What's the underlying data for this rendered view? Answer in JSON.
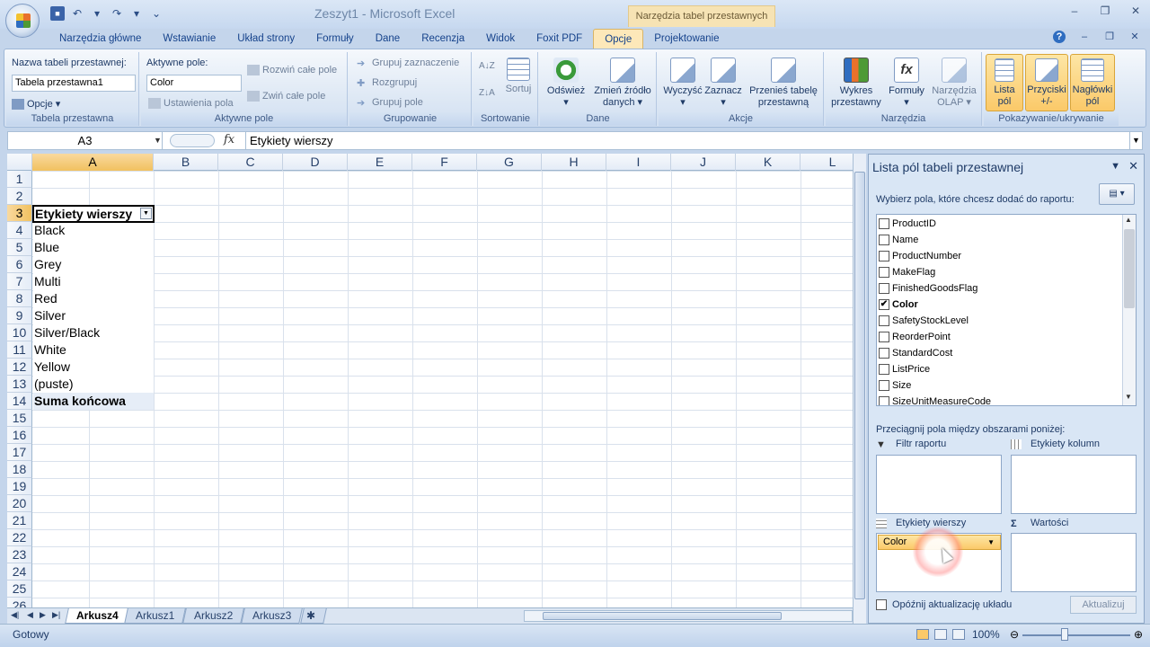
{
  "window": {
    "title": "Zeszyt1 - Microsoft Excel",
    "context_title": "Narzędzia tabel przestawnych"
  },
  "tabs": [
    {
      "label": "Narzędzia główne"
    },
    {
      "label": "Wstawianie"
    },
    {
      "label": "Układ strony"
    },
    {
      "label": "Formuły"
    },
    {
      "label": "Dane"
    },
    {
      "label": "Recenzja"
    },
    {
      "label": "Widok"
    },
    {
      "label": "Foxit PDF"
    },
    {
      "label": "Opcje",
      "active": true
    },
    {
      "label": "Projektowanie"
    }
  ],
  "ribbon": {
    "pivot_table": {
      "name_label": "Nazwa tabeli przestawnej:",
      "name_value": "Tabela przestawna1",
      "options_label": "Opcje",
      "group_label": "Tabela przestawna"
    },
    "active_field": {
      "label": "Aktywne pole:",
      "value": "Color",
      "settings_label": "Ustawienia pola",
      "expand_label": "Rozwiń całe pole",
      "collapse_label": "Zwiń całe pole",
      "group_label": "Aktywne pole"
    },
    "grouping": {
      "group_selection": "Grupuj zaznaczenie",
      "ungroup": "Rozgrupuj",
      "group_field": "Grupuj pole",
      "group_label": "Grupowanie"
    },
    "sorting": {
      "sort_label": "Sortuj",
      "group_label": "Sortowanie"
    },
    "data": {
      "refresh_label": "Odśwież",
      "change_source_label_1": "Zmień źródło",
      "change_source_label_2": "danych",
      "group_label": "Dane"
    },
    "actions": {
      "clear_label": "Wyczyść",
      "select_label": "Zaznacz",
      "move_label_1": "Przenieś tabelę",
      "move_label_2": "przestawną",
      "group_label": "Akcje"
    },
    "tools": {
      "chart_label_1": "Wykres",
      "chart_label_2": "przestawny",
      "formulas_label": "Formuły",
      "olap_label_1": "Narzędzia",
      "olap_label_2": "OLAP",
      "group_label": "Narzędzia"
    },
    "show_hide": {
      "field_list_1": "Lista",
      "field_list_2": "pól",
      "buttons_1": "Przyciski",
      "buttons_2": "+/-",
      "headers_1": "Nagłówki",
      "headers_2": "pól",
      "group_label": "Pokazywanie/ukrywanie"
    }
  },
  "formula_bar": {
    "name_box": "A3",
    "fx_label": "fx",
    "value": "Etykiety wierszy"
  },
  "grid": {
    "columns": [
      "A",
      "B",
      "C",
      "D",
      "E",
      "F",
      "G",
      "H",
      "I",
      "J",
      "K",
      "L"
    ],
    "rows": [
      "1",
      "2",
      "3",
      "4",
      "5",
      "6",
      "7",
      "8",
      "9",
      "10",
      "11",
      "12",
      "13",
      "14",
      "15",
      "16",
      "17",
      "18",
      "19",
      "20",
      "21",
      "22",
      "23",
      "24",
      "25",
      "26"
    ],
    "header_cell": "Etykiety wierszy",
    "row_values": [
      "Black",
      "Blue",
      "Grey",
      "Multi",
      "Red",
      "Silver",
      "Silver/Black",
      "White",
      "Yellow",
      "(puste)"
    ],
    "total_label": "Suma końcowa"
  },
  "sheet_tabs": [
    {
      "label": "Arkusz4",
      "active": true
    },
    {
      "label": "Arkusz1"
    },
    {
      "label": "Arkusz2"
    },
    {
      "label": "Arkusz3"
    }
  ],
  "status_bar": {
    "status": "Gotowy",
    "zoom": "100%"
  },
  "field_list": {
    "title": "Lista pól tabeli przestawnej",
    "choose_label": "Wybierz pola, które chcesz dodać do raportu:",
    "fields": [
      {
        "name": "ProductID",
        "checked": false
      },
      {
        "name": "Name",
        "checked": false
      },
      {
        "name": "ProductNumber",
        "checked": false
      },
      {
        "name": "MakeFlag",
        "checked": false
      },
      {
        "name": "FinishedGoodsFlag",
        "checked": false
      },
      {
        "name": "Color",
        "checked": true
      },
      {
        "name": "SafetyStockLevel",
        "checked": false
      },
      {
        "name": "ReorderPoint",
        "checked": false
      },
      {
        "name": "StandardCost",
        "checked": false
      },
      {
        "name": "ListPrice",
        "checked": false
      },
      {
        "name": "Size",
        "checked": false
      },
      {
        "name": "SizeUnitMeasureCode",
        "checked": false
      }
    ],
    "drag_label": "Przeciągnij pola między obszarami poniżej:",
    "report_filter": "Filtr raportu",
    "column_labels": "Etykiety kolumn",
    "row_labels": "Etykiety wierszy",
    "values": "Wartości",
    "row_chip": "Color",
    "defer_label": "Opóźnij aktualizację układu",
    "update_label": "Aktualizuj"
  },
  "colors": {
    "accent": "#fbc969",
    "ribbon_text": "#15428b"
  }
}
